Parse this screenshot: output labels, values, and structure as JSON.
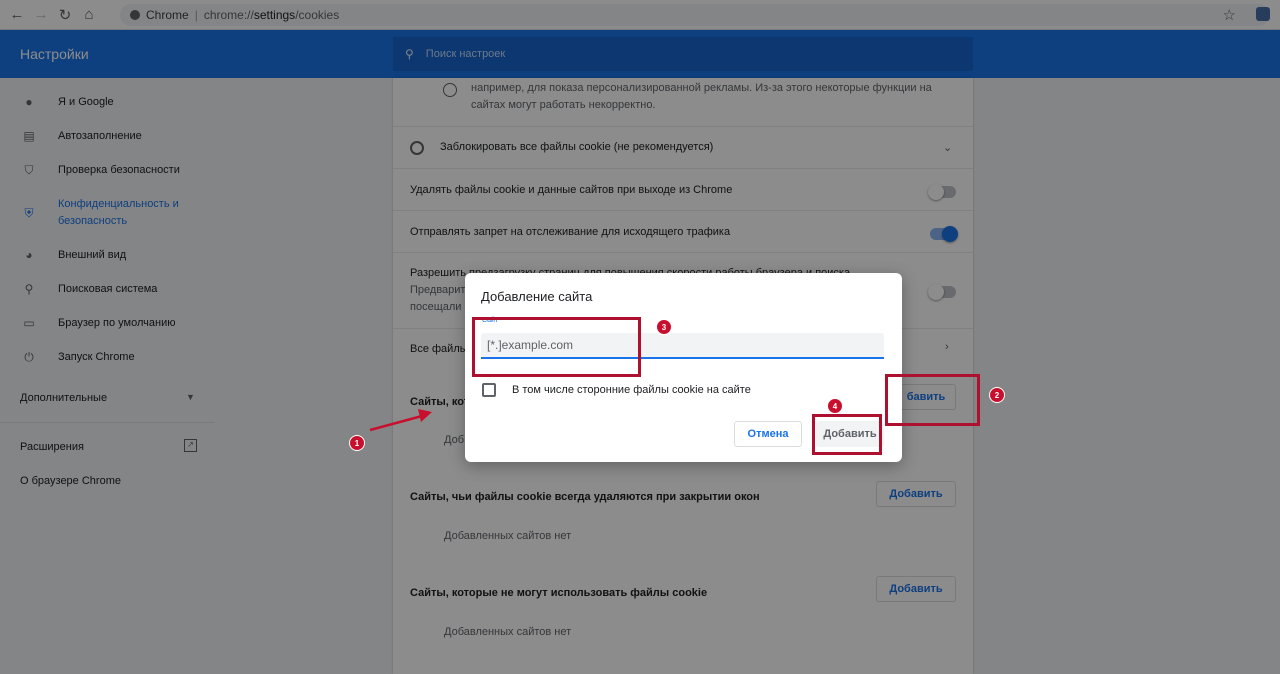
{
  "browser": {
    "site_name": "Chrome",
    "url_prefix": "chrome://",
    "url_path": "settings",
    "url_suffix": "/cookies"
  },
  "header": {
    "title": "Настройки",
    "search_placeholder": "Поиск настроек"
  },
  "sidebar": {
    "items": [
      {
        "label": "Я и Google",
        "icon": "person-icon"
      },
      {
        "label": "Автозаполнение",
        "icon": "clipboard-icon"
      },
      {
        "label": "Проверка безопасности",
        "icon": "shield-check-icon"
      },
      {
        "label": "Конфиденциальность и безопасность",
        "icon": "shield-icon"
      },
      {
        "label": "Внешний вид",
        "icon": "palette-icon"
      },
      {
        "label": "Поисковая система",
        "icon": "search-icon"
      },
      {
        "label": "Браузер по умолчанию",
        "icon": "browser-icon"
      },
      {
        "label": "Запуск Chrome",
        "icon": "power-icon"
      }
    ],
    "advanced": "Дополнительные",
    "extensions": "Расширения",
    "about": "О браузере Chrome"
  },
  "content": {
    "partial_text": "например, для показа персонализированной рекламы. Из-за этого некоторые функции на сайтах могут работать некорректно.",
    "block_all": "Заблокировать все файлы cookie (не рекомендуется)",
    "clear_on_exit": "Удалять файлы cookie и данные сайтов при выходе из Chrome",
    "do_not_track": "Отправлять запрет на отслеживание для исходящего трафика",
    "preload_line1": "Разрешить предзагрузку страниц для повышения скорости работы браузера и поиска",
    "preload_line2": "Предварит",
    "preload_line3": "посещали",
    "all_files": "Все файлы",
    "always_allow_prefix": "Сайты, кот",
    "always_allow_empty_prefix": "Доб",
    "clear_on_close": "Сайты, чьи файлы cookie всегда удаляются при закрытии окон",
    "never_allow": "Сайты, которые не могут использовать файлы cookie",
    "no_sites": "Добавленных сайтов нет",
    "add_button": "Добавить",
    "add_button_partial": "бавить"
  },
  "dialog": {
    "title": "Добавление сайта",
    "field_label": "Сайт",
    "placeholder": "[*.]example.com",
    "checkbox_label": "В том числе сторонние файлы cookie на сайте",
    "cancel": "Отмена",
    "add": "Добавить"
  },
  "annotations": {
    "badges": [
      "1",
      "2",
      "3",
      "4"
    ],
    "color": "#c8102e"
  },
  "toggles": {
    "clear_on_exit": false,
    "do_not_track": true,
    "preload": false
  }
}
